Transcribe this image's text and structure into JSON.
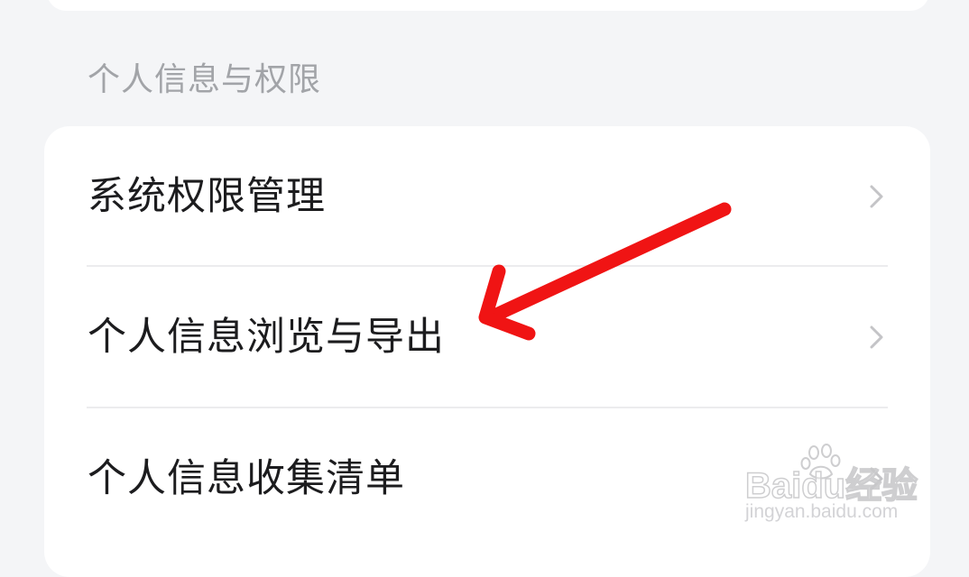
{
  "section": {
    "title": "个人信息与权限"
  },
  "menu": {
    "items": [
      {
        "label": "系统权限管理",
        "icon": "chevron-right-icon"
      },
      {
        "label": "个人信息浏览与导出",
        "icon": "chevron-right-icon"
      },
      {
        "label": "个人信息收集清单",
        "icon": "chevron-right-icon"
      }
    ]
  },
  "watermark": {
    "brand": "Baidu经验",
    "url": "jingyan.baidu.com"
  },
  "colors": {
    "background": "#f4f5f7",
    "card": "#ffffff",
    "section_title": "#a2a4a8",
    "item_text": "#1c1c1e",
    "chevron": "#c4c4c7",
    "annotation_arrow": "#f01414"
  }
}
